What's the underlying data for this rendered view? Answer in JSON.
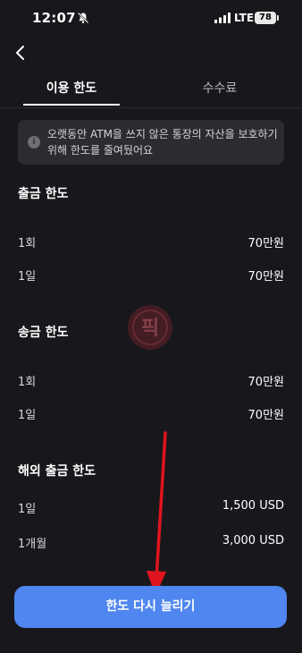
{
  "status_bar": {
    "time": "12:07",
    "network": "LTE",
    "battery": "78",
    "icons": [
      "bell-off-icon",
      "signal-icon"
    ]
  },
  "nav": {
    "back_icon": "chevron-left-icon"
  },
  "tabs": [
    {
      "label": "이용 한도",
      "active": true
    },
    {
      "label": "수수료",
      "active": false
    }
  ],
  "notice": {
    "icon": "info-icon",
    "icon_glyph": "i",
    "text": "오랫동안 ATM을 쓰지 않은 통장의 자산을 보호하기 위해 한도를 줄여뒀어요"
  },
  "sections": [
    {
      "title": "출금 한도",
      "rows": [
        {
          "label": "1회",
          "value": "70만원"
        },
        {
          "label": "1일",
          "value": "70만원"
        }
      ]
    },
    {
      "title": "송금 한도",
      "rows": [
        {
          "label": "1회",
          "value": "70만원"
        },
        {
          "label": "1일",
          "value": "70만원"
        }
      ]
    },
    {
      "title": "해외 출금 한도",
      "rows": [
        {
          "label": "1일",
          "value": "1,500 USD"
        },
        {
          "label": "1개월",
          "value": "3,000 USD"
        }
      ]
    }
  ],
  "watermark": {
    "text": "픽"
  },
  "cta": {
    "label": "한도 다시 늘리기"
  },
  "colors": {
    "background": "#18181c",
    "card": "#2b2c31",
    "accent": "#4f86ef",
    "annotation": "#e0141e"
  }
}
